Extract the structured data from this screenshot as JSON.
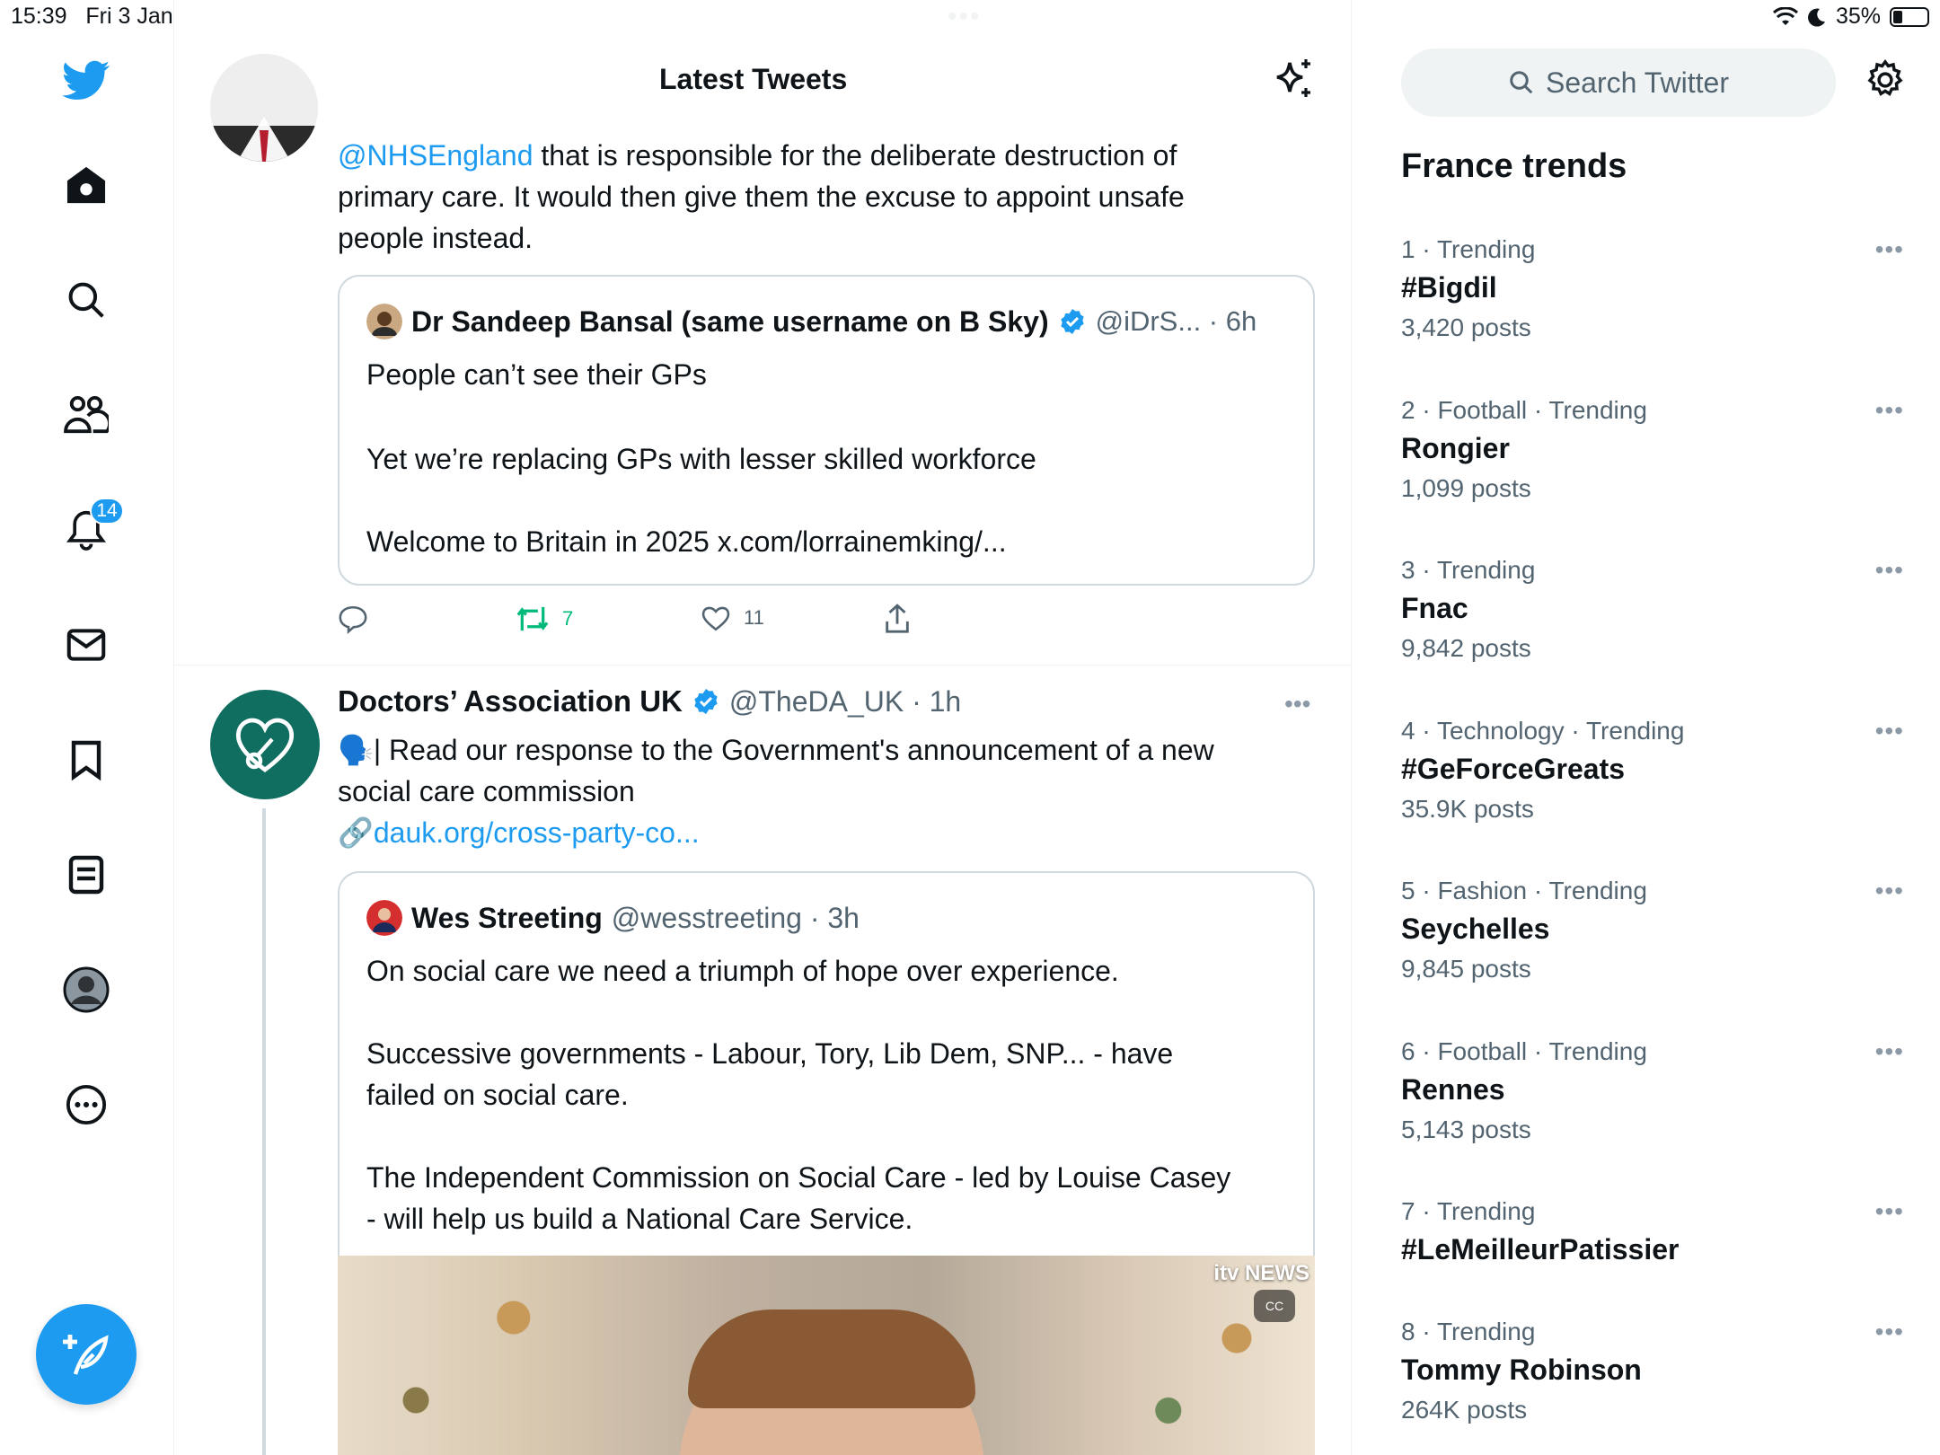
{
  "status_bar": {
    "time_date": "15:39   Fri 3 Jan",
    "battery": "35%",
    "battery_level": 0.35
  },
  "nav": {
    "notifications_badge": "14"
  },
  "header": {
    "title": "Latest Tweets"
  },
  "tweet1": {
    "mention": "@NHSEngland",
    "text_after_mention": " that is responsible for the deliberate destruction of",
    "text_line2": "primary care.  It would then give them the excuse to appoint unsafe",
    "text_line3": "people instead.",
    "quote": {
      "name": "Dr Sandeep Bansal (same username on B Sky)",
      "handle_time": "@iDrS... · 6h",
      "line1": "People can’t see their GPs",
      "line2": "Yet we’re replacing GPs with lesser skilled workforce",
      "line3": "Welcome to Britain in 2025 x.com/lorrainemking/..."
    },
    "retweets": "7",
    "likes": "11"
  },
  "tweet2": {
    "name": "Doctors’ Association UK",
    "handle_time": "@TheDA_UK · 1h",
    "emoji": "🗣️|",
    "text_line1": " Read our response to the Government's announcement of a new",
    "text_line2": "social care commission",
    "link_emoji": "🔗",
    "link": "dauk.org/cross-party-co...",
    "quote": {
      "name": "Wes Streeting",
      "handle_time": "@wesstreeting · 3h",
      "p1": "On social care we need a triumph of hope over experience.",
      "p2_line1": "Successive governments - Labour, Tory, Lib Dem, SNP... - have",
      "p2_line2": "failed on social care.",
      "p3_line1": "The Independent Commission on Social Care - led by Louise Casey",
      "p3_line2": "- will help us build a National Care Service."
    },
    "media_logo": "itv NEWS",
    "media_cc": "CC"
  },
  "sidebar": {
    "search_placeholder": "Search Twitter",
    "trends_title": "France trends",
    "trends": [
      {
        "meta": "1 · Trending",
        "name": "#Bigdil",
        "count": "3,420 posts"
      },
      {
        "meta": "2 · Football · Trending",
        "name": "Rongier",
        "count": "1,099 posts"
      },
      {
        "meta": "3 · Trending",
        "name": "Fnac",
        "count": "9,842 posts"
      },
      {
        "meta": "4 · Technology · Trending",
        "name": "#GeForceGreats",
        "count": "35.9K posts"
      },
      {
        "meta": "5 · Fashion · Trending",
        "name": "Seychelles",
        "count": "9,845 posts"
      },
      {
        "meta": "6 · Football · Trending",
        "name": "Rennes",
        "count": "5,143 posts"
      },
      {
        "meta": "7 · Trending",
        "name": "#LeMeilleurPatissier",
        "count": ""
      },
      {
        "meta": "8 · Trending",
        "name": "Tommy Robinson",
        "count": "264K posts"
      }
    ],
    "more_glyph": "•••"
  },
  "colors": {
    "accent": "#1d9bf0",
    "retweet_green": "#00ba7c",
    "muted": "#536471",
    "dauk_teal": "#0f6e60"
  }
}
